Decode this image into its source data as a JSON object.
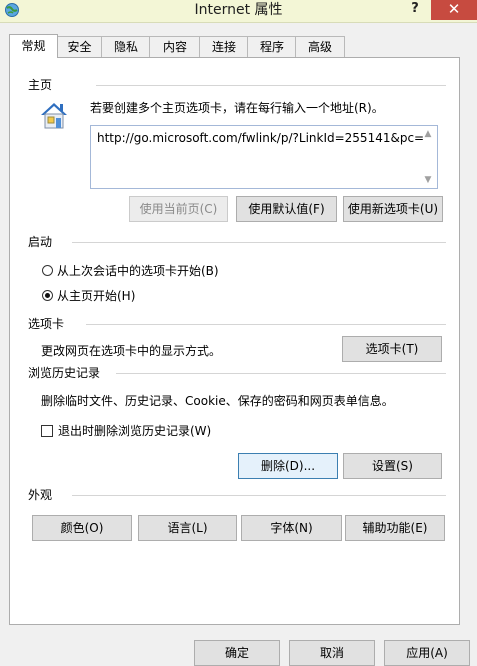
{
  "window": {
    "title": "Internet 属性",
    "help_symbol": "?",
    "close_symbol": "✕",
    "close_color": "#c74b40",
    "icon": "internet-options-icon"
  },
  "tabs": [
    {
      "label": "常规",
      "active": true
    },
    {
      "label": "安全",
      "active": false
    },
    {
      "label": "隐私",
      "active": false
    },
    {
      "label": "内容",
      "active": false
    },
    {
      "label": "连接",
      "active": false
    },
    {
      "label": "程序",
      "active": false
    },
    {
      "label": "高级",
      "active": false
    }
  ],
  "homepage": {
    "section_title": "主页",
    "instruction": "若要创建多个主页选项卡，请在每行输入一个地址(R)。",
    "url_value": "http://go.microsoft.com/fwlink/p/?LinkId=255141&pc=",
    "icon": "house-icon",
    "buttons": {
      "use_current": "使用当前页(C)",
      "use_default": "使用默认值(F)",
      "use_new_tab": "使用新选项卡(U)"
    }
  },
  "startup": {
    "section_title": "启动",
    "option_last_session": "从上次会话中的选项卡开始(B)",
    "option_home_page": "从主页开始(H)",
    "selected": "home_page"
  },
  "tabs_section": {
    "section_title": "选项卡",
    "description": "更改网页在选项卡中的显示方式。",
    "button": "选项卡(T)"
  },
  "history": {
    "section_title": "浏览历史记录",
    "description": "删除临时文件、历史记录、Cookie、保存的密码和网页表单信息。",
    "delete_on_exit_label": "退出时删除浏览历史记录(W)",
    "delete_on_exit_checked": false,
    "delete_button": "删除(D)...",
    "settings_button": "设置(S)"
  },
  "appearance": {
    "section_title": "外观",
    "colors_button": "颜色(O)",
    "languages_button": "语言(L)",
    "fonts_button": "字体(N)",
    "accessibility_button": "辅助功能(E)"
  },
  "footer": {
    "ok_button": "确定",
    "cancel_button": "取消",
    "apply_button": "应用(A)"
  }
}
